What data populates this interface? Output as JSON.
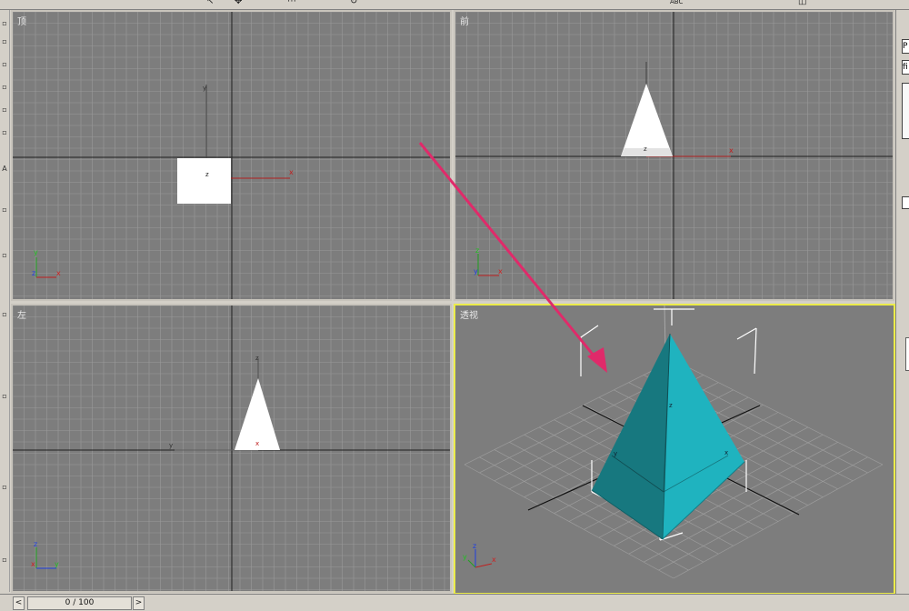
{
  "viewports": {
    "top": {
      "label": "顶"
    },
    "front": {
      "label": "前"
    },
    "left": {
      "label": "左"
    },
    "perspective": {
      "label": "透视"
    }
  },
  "axis_letters": {
    "x": "x",
    "y": "y",
    "z": "z"
  },
  "timeline": {
    "position": "0 / 100",
    "prev_symbol": "<",
    "next_symbol": ">"
  },
  "command_panel": {
    "field1": "P",
    "field2": "fi"
  },
  "toolbar": {
    "abc": "ABC"
  },
  "colors": {
    "viewport_bg": "#7d7d7d",
    "grid": "#9a9a9a",
    "active_border": "#ecec4a",
    "pyramid_dark": "#17787f",
    "pyramid_light": "#1fb3bf",
    "annotation_arrow": "#e02a6a"
  },
  "scene_object": {
    "type": "pyramid",
    "selected": true
  }
}
